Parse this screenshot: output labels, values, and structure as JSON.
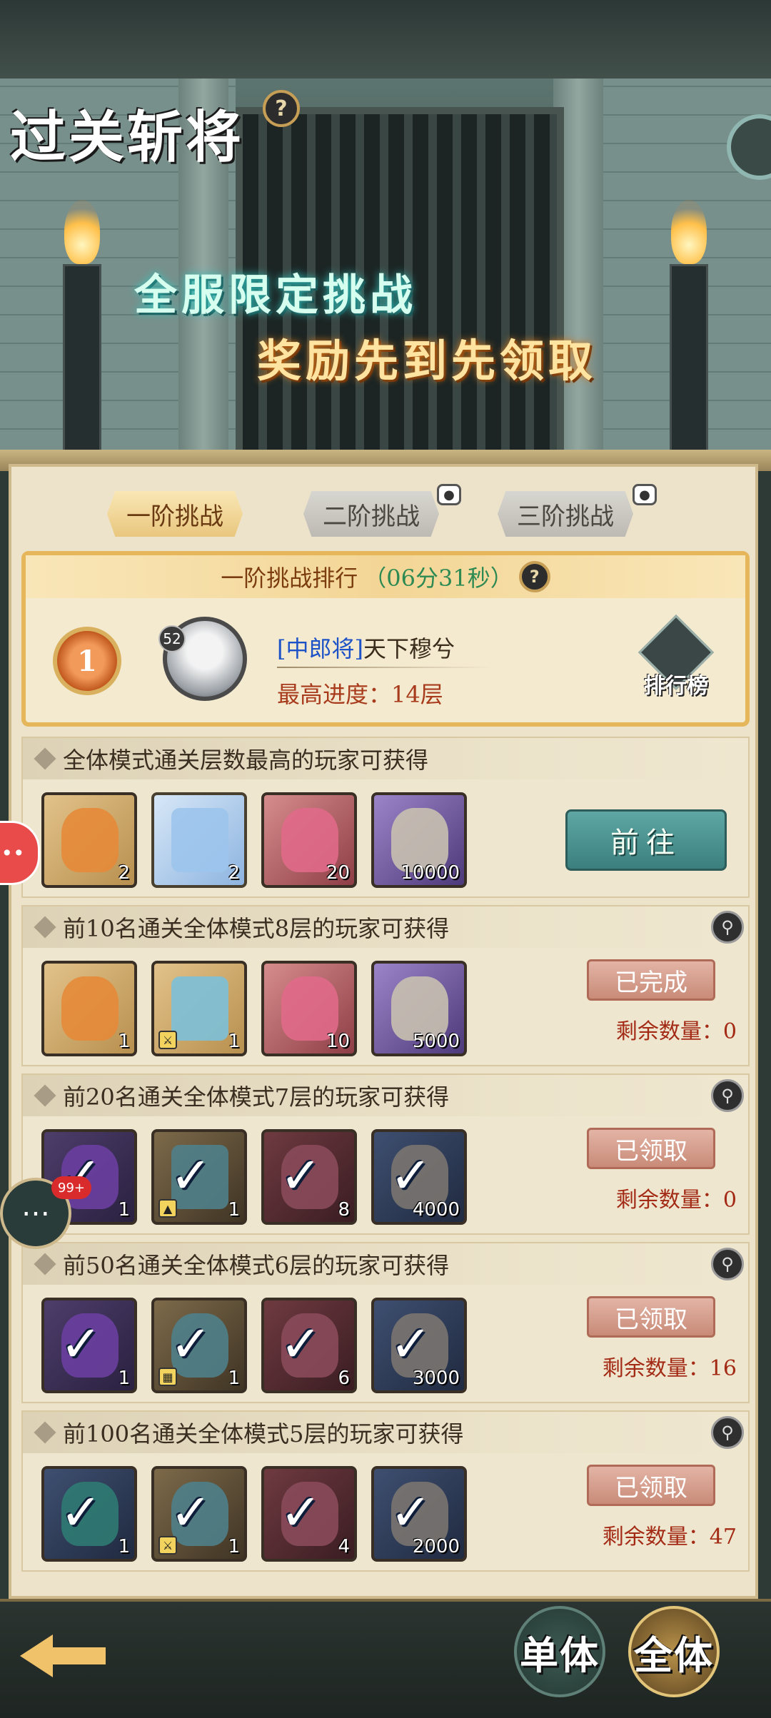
{
  "banner": {
    "title": "过关斩将",
    "help_glyph": "?",
    "subtitle_1": "全服限定挑战",
    "subtitle_2": "奖励先到先领取"
  },
  "tabs": [
    {
      "label": "一阶挑战",
      "active": true,
      "locked": false
    },
    {
      "label": "二阶挑战",
      "active": false,
      "locked": true
    },
    {
      "label": "三阶挑战",
      "active": false,
      "locked": true
    }
  ],
  "ranking": {
    "header": "一阶挑战排行",
    "timer": "（06分31秒）",
    "help_glyph": "?",
    "player_level": "52",
    "player_rank_tag": "[中郎将]",
    "player_name": "天下穆兮",
    "progress_text": "最高进度：14层",
    "leaderboard_label": "排行榜"
  },
  "sections": [
    {
      "title": "全体模式通关层数最高的玩家可获得",
      "items": [
        {
          "icon": "orange-beast-token-icon",
          "count": "2"
        },
        {
          "icon": "crystal-chest-icon",
          "count": "2"
        },
        {
          "icon": "red-beast-icon",
          "count": "20"
        },
        {
          "icon": "scroll-sword-icon",
          "count": "10000"
        }
      ],
      "button": "前往"
    },
    {
      "title": "前10名通关全体模式8层的玩家可获得",
      "items": [
        {
          "icon": "orange-beast-token-icon",
          "count": "1"
        },
        {
          "icon": "crystal-chest-icon",
          "count": "1"
        },
        {
          "icon": "red-beast-icon",
          "count": "10"
        },
        {
          "icon": "scroll-sword-icon",
          "count": "5000"
        }
      ],
      "status": "已完成",
      "remaining": "剩余数量：0"
    },
    {
      "title": "前20名通关全体模式7层的玩家可获得",
      "items": [
        {
          "icon": "purple-beast-token-icon",
          "count": "1"
        },
        {
          "icon": "crystal-chest-icon",
          "count": "1"
        },
        {
          "icon": "red-beast-icon",
          "count": "8"
        },
        {
          "icon": "scroll-sword-icon",
          "count": "4000"
        }
      ],
      "status": "已领取",
      "remaining": "剩余数量：0"
    },
    {
      "title": "前50名通关全体模式6层的玩家可获得",
      "items": [
        {
          "icon": "purple-beast-token-icon",
          "count": "1"
        },
        {
          "icon": "crystal-stone-icon",
          "count": "1"
        },
        {
          "icon": "red-beast-icon",
          "count": "6"
        },
        {
          "icon": "scroll-sword-icon",
          "count": "3000"
        }
      ],
      "status": "已领取",
      "remaining": "剩余数量：16"
    },
    {
      "title": "前100名通关全体模式5层的玩家可获得",
      "items": [
        {
          "icon": "green-beast-token-icon",
          "count": "1"
        },
        {
          "icon": "crystal-stone-icon",
          "count": "1"
        },
        {
          "icon": "red-beast-icon",
          "count": "4"
        },
        {
          "icon": "scroll-sword-icon",
          "count": "2000"
        }
      ],
      "status": "已领取",
      "remaining": "剩余数量：47"
    }
  ],
  "chat_badge": "99+",
  "bottom": {
    "mode_single": "单体",
    "mode_all": "全体"
  },
  "colors": {
    "accent_gold": "#e6b65a",
    "go_button": "#4b9391",
    "status_pink": "#d49e8e",
    "remaining_red": "#a32b16",
    "timer_green": "#2e8a53"
  }
}
